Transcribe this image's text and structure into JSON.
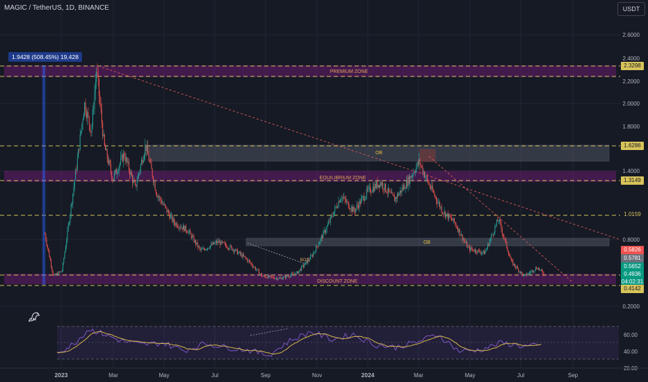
{
  "header": {
    "symbol_line": "MAGIC / TetherUS, 1D, BINANCE",
    "currency_button": "USDT"
  },
  "measure_label": "1.9428 (508.45%) 19,428",
  "zones": {
    "premium": "PREMIUM ZONE",
    "equilibrium": "EQUILIBRIUM ZONE",
    "discount": "DISCOUNT ZONE",
    "ob_upper": "OB",
    "ob_lower": "OB",
    "bos": "BOS"
  },
  "price_labels": {
    "premium_level": "2.3298",
    "ob_top": "1.6286",
    "equilibrium_level": "1.3149",
    "mid_level": "1.0159",
    "high_mark": "0.5826",
    "prev_close": "0.5781",
    "current": "0.5652",
    "last_price": "0.4936",
    "countdown": "04:02:31",
    "discount_level": "0.4142"
  },
  "chart_data": {
    "type": "candlestick",
    "price_axis_ticks": [
      "2.6000",
      "2.4000",
      "2.2000",
      "2.0000",
      "1.8000",
      "1.4000",
      "0.8000",
      "0.2000"
    ],
    "rsi_axis_ticks": [
      "60.00",
      "40.00",
      "20.00"
    ],
    "time_axis_ticks": [
      "2023",
      "Mar",
      "May",
      "Jul",
      "Sep",
      "Nov",
      "2024",
      "Mar",
      "May",
      "Jul",
      "Sep"
    ],
    "ohlc_path": [
      [
        "2022-12-26",
        0.85
      ],
      [
        "2023-01-05",
        0.47
      ],
      [
        "2023-01-15",
        0.52
      ],
      [
        "2023-02-01",
        1.45
      ],
      [
        "2023-02-10",
        2.0
      ],
      [
        "2023-02-18",
        1.75
      ],
      [
        "2023-02-24",
        2.3
      ],
      [
        "2023-03-05",
        1.62
      ],
      [
        "2023-03-15",
        1.33
      ],
      [
        "2023-03-28",
        1.55
      ],
      [
        "2023-04-10",
        1.25
      ],
      [
        "2023-04-22",
        1.63
      ],
      [
        "2023-05-05",
        1.2
      ],
      [
        "2023-05-25",
        0.95
      ],
      [
        "2023-06-10",
        0.88
      ],
      [
        "2023-06-25",
        0.7
      ],
      [
        "2023-07-15",
        0.78
      ],
      [
        "2023-08-01",
        0.72
      ],
      [
        "2023-08-18",
        0.62
      ],
      [
        "2023-09-05",
        0.47
      ],
      [
        "2023-09-25",
        0.45
      ],
      [
        "2023-10-15",
        0.5
      ],
      [
        "2023-11-01",
        0.65
      ],
      [
        "2023-11-20",
        0.93
      ],
      [
        "2023-12-05",
        1.18
      ],
      [
        "2023-12-20",
        1.05
      ],
      [
        "2024-01-05",
        1.22
      ],
      [
        "2024-01-20",
        1.3
      ],
      [
        "2024-02-05",
        1.15
      ],
      [
        "2024-02-20",
        1.3
      ],
      [
        "2024-03-05",
        1.48
      ],
      [
        "2024-03-15",
        1.3
      ],
      [
        "2024-04-01",
        1.05
      ],
      [
        "2024-04-15",
        0.95
      ],
      [
        "2024-05-01",
        0.72
      ],
      [
        "2024-05-20",
        0.68
      ],
      [
        "2024-06-05",
        0.98
      ],
      [
        "2024-06-20",
        0.6
      ],
      [
        "2024-07-05",
        0.47
      ],
      [
        "2024-07-20",
        0.55
      ],
      [
        "2024-07-28",
        0.49
      ]
    ],
    "rsi_path": [
      [
        0.0,
        30
      ],
      [
        0.03,
        42
      ],
      [
        0.06,
        66
      ],
      [
        0.09,
        58
      ],
      [
        0.12,
        48
      ],
      [
        0.16,
        42
      ],
      [
        0.2,
        45
      ],
      [
        0.24,
        33
      ],
      [
        0.28,
        44
      ],
      [
        0.32,
        38
      ],
      [
        0.36,
        34
      ],
      [
        0.4,
        26
      ],
      [
        0.44,
        48
      ],
      [
        0.48,
        62
      ],
      [
        0.52,
        50
      ],
      [
        0.56,
        58
      ],
      [
        0.6,
        42
      ],
      [
        0.64,
        38
      ],
      [
        0.68,
        46
      ],
      [
        0.72,
        58
      ],
      [
        0.76,
        32
      ],
      [
        0.8,
        34
      ],
      [
        0.84,
        45
      ],
      [
        0.88,
        40
      ],
      [
        0.92,
        40
      ]
    ],
    "grid": true
  },
  "colors": {
    "bullish": "#26a69a",
    "bearish": "#ef5350",
    "zone_fill": "#6a1b6e",
    "level_line": "#d8c35a",
    "trendline": "#e05a5a",
    "rsi_line": "#7e57c2",
    "rsi_ma": "#d6b84a"
  },
  "icons": {
    "logo": "tradingview-dino-icon"
  }
}
